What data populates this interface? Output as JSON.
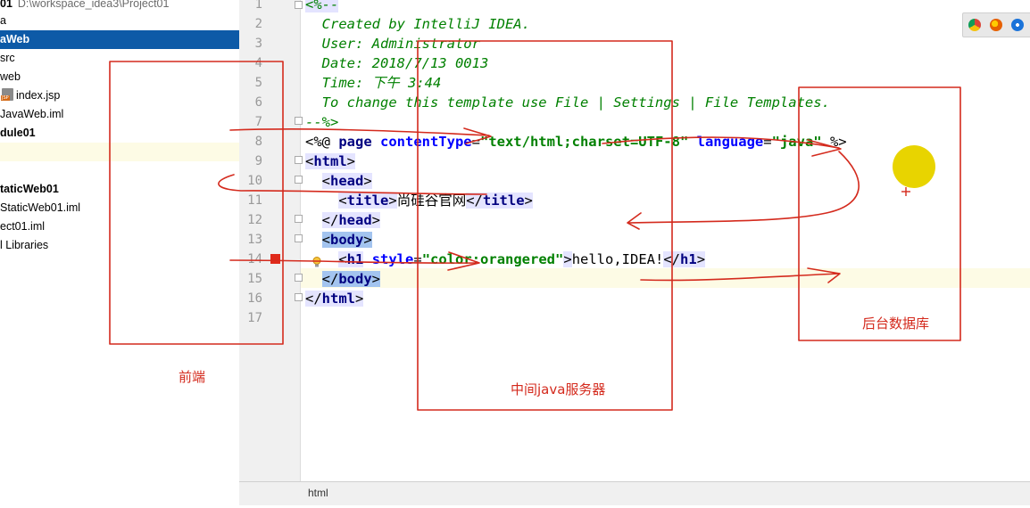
{
  "project_tree": {
    "rows": [
      {
        "text": "01",
        "path": "D:\\workspace_idea3\\Project01"
      },
      {
        "text": "a"
      },
      {
        "text": "aWeb"
      },
      {
        "text": "src"
      },
      {
        "text": "web"
      },
      {
        "text": "index.jsp"
      },
      {
        "text": "JavaWeb.iml"
      },
      {
        "text": "dule01"
      },
      {
        "text": ""
      },
      {
        "text": "taticWeb01"
      },
      {
        "text": "StaticWeb01.iml"
      },
      {
        "text": "ect01.iml"
      },
      {
        "text": "l Libraries"
      }
    ]
  },
  "editor": {
    "line_numbers": [
      "1",
      "2",
      "3",
      "4",
      "5",
      "6",
      "7",
      "8",
      "9",
      "10",
      "11",
      "12",
      "13",
      "14",
      "15",
      "16",
      "17"
    ],
    "lines": {
      "l1": "<%--",
      "l2": "  Created by IntelliJ IDEA.",
      "l3": "  User: Administrator",
      "l4": "  Date: 2018/7/13 0013",
      "l5": "  Time: 下午 3:44",
      "l6": "  To change this template use File | Settings | File Templates.",
      "l7": "--%>",
      "l8_a": "<%@ ",
      "l8_b": "page",
      "l8_c": " contentType",
      "l8_d": "=",
      "l8_e": "\"text/html;charset=UTF-8\"",
      "l8_f": " language",
      "l8_g": "=",
      "l8_h": "\"java\"",
      "l8_i": " %>",
      "l9": "html",
      "l10": "head",
      "l11_tag": "title",
      "l11_text": "尚硅谷官网",
      "l13": "body",
      "l14_tag": "h1",
      "l14_attr": "style",
      "l14_val": "\"color:orangered\"",
      "l14_text": "hello,IDEA!",
      "l15": "body",
      "l16": "html"
    }
  },
  "breadcrumb": "html",
  "annotations": {
    "frontend": "前端",
    "middle": "中间java服务器",
    "backend": "后台数据库"
  },
  "colors": {
    "selection": "#0d5aa7",
    "annotation": "#d42a1d",
    "cursor_dot": "#e8d400"
  },
  "icons": [
    "chrome-icon",
    "firefox-icon",
    "safari-icon",
    "bulb-icon",
    "breakpoint-icon"
  ]
}
